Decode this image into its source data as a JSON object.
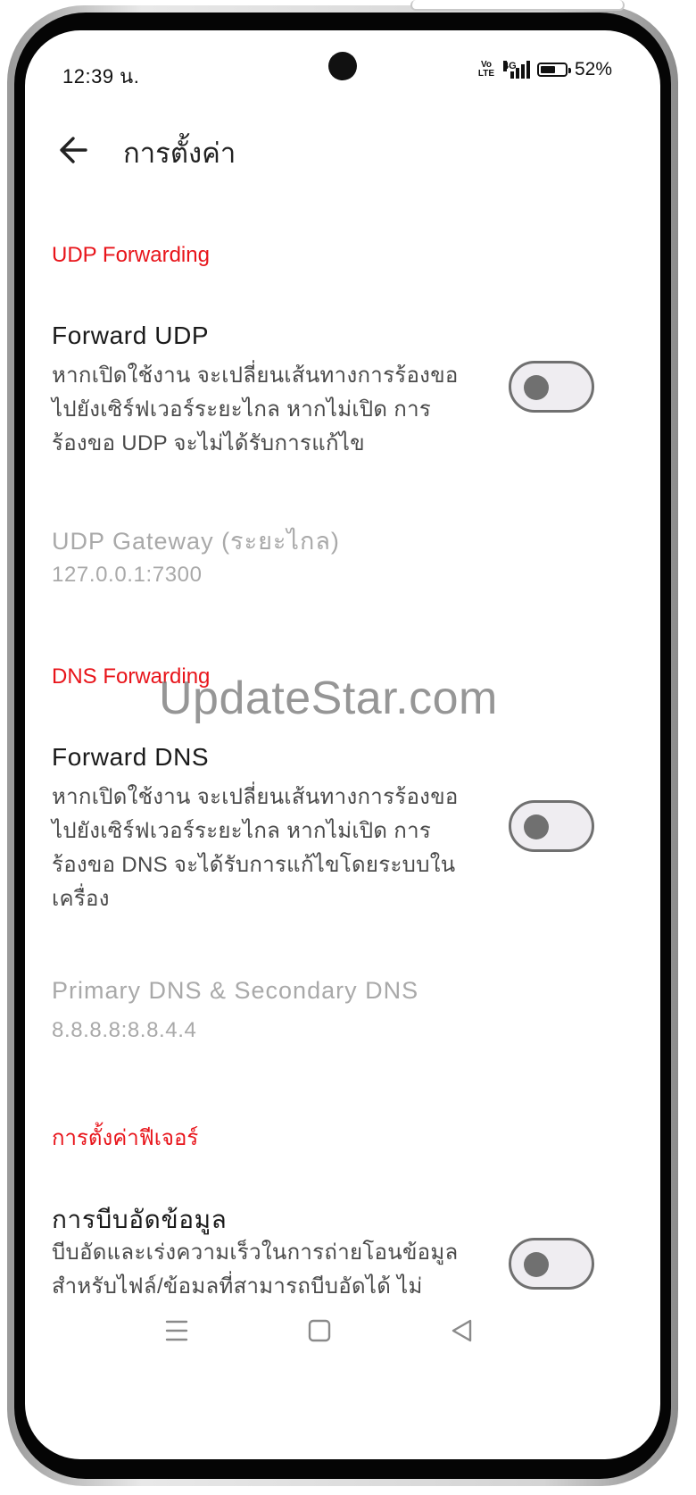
{
  "status_bar": {
    "time": "12:39 น.",
    "volte": [
      "Vo",
      "LTE"
    ],
    "network": "4G",
    "battery_percent": "52%"
  },
  "header": {
    "title": "การตั้งค่า"
  },
  "sections": {
    "udp": {
      "heading": "UDP Forwarding",
      "forward_udp": {
        "title": "Forward UDP",
        "description": "หากเปิดใช้งาน จะเปลี่ยนเส้นทางการร้องขอไปยังเซิร์ฟเวอร์ระยะไกล หากไม่เปิด การร้องขอ UDP จะไม่ได้รับการแก้ไข",
        "enabled": false
      },
      "gateway": {
        "title": "UDP Gateway (ระยะไกล)",
        "value": "127.0.0.1:7300"
      }
    },
    "dns": {
      "heading": "DNS Forwarding",
      "forward_dns": {
        "title": "Forward DNS",
        "description": "หากเปิดใช้งาน จะเปลี่ยนเส้นทางการร้องขอไปยังเซิร์ฟเวอร์ระยะไกล หากไม่เปิด การร้องขอ DNS จะได้รับการแก้ไขโดยระบบในเครื่อง",
        "enabled": false
      },
      "servers": {
        "title": "Primary DNS & Secondary DNS",
        "value": "8.8.8.8:8.8.4.4"
      }
    },
    "features": {
      "heading": "การตั้งค่าฟีเจอร์",
      "compression": {
        "title": "การบีบอัดข้อมูล",
        "description": "บีบอัดและเร่งความเร็วในการถ่ายโอนข้อมูลสำหรับไฟล์/ข้อมลที่สามารถบีบอัดได้ ไม่",
        "enabled": false
      }
    }
  },
  "watermark": "UpdateStar.com",
  "colors": {
    "accent": "#e8141a",
    "disabled_text": "#a9a9a9",
    "toggle_off": "#707070"
  },
  "icons": {
    "back": "arrow-left-icon",
    "menu": "menu-icon",
    "home": "home-icon",
    "nav_back": "triangle-back-icon"
  }
}
